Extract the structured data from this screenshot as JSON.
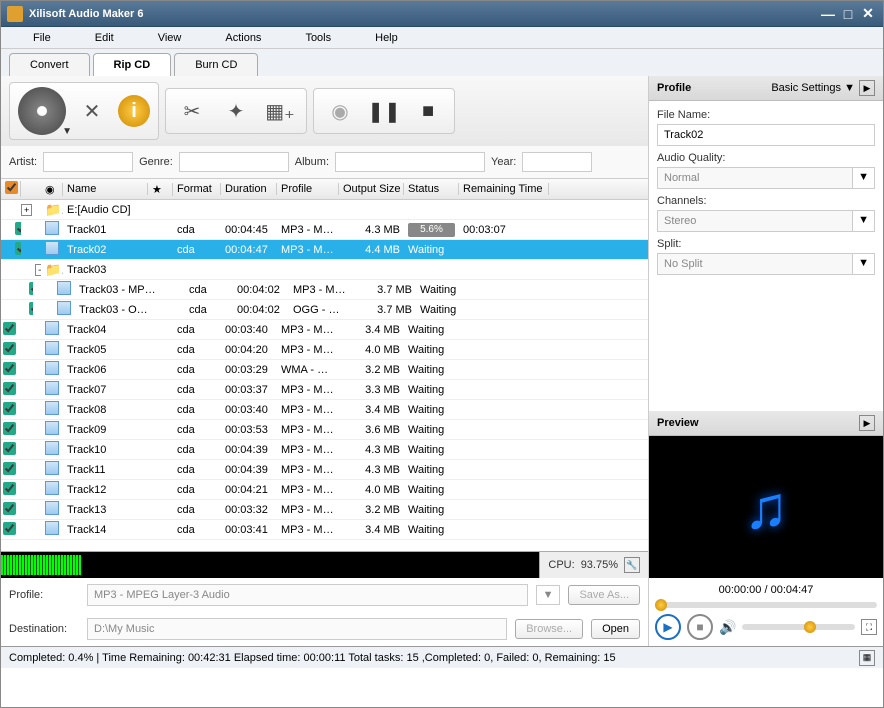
{
  "window": {
    "title": "Xilisoft Audio Maker 6"
  },
  "menu": [
    "File",
    "Edit",
    "View",
    "Actions",
    "Tools",
    "Help"
  ],
  "tabs": [
    {
      "label": "Convert",
      "active": false
    },
    {
      "label": "Rip CD",
      "active": true
    },
    {
      "label": "Burn CD",
      "active": false
    }
  ],
  "meta": {
    "artist_label": "Artist:",
    "artist": "",
    "genre_label": "Genre:",
    "genre": "",
    "album_label": "Album:",
    "album": "",
    "year_label": "Year:",
    "year": ""
  },
  "columns": {
    "name": "Name",
    "format": "Format",
    "duration": "Duration",
    "profile": "Profile",
    "outsize": "Output Size",
    "status": "Status",
    "remaining": "Remaining Time"
  },
  "rows": [
    {
      "type": "group",
      "icon": "folder-open",
      "name": "E:[Audio CD]",
      "expanded": true
    },
    {
      "type": "item",
      "checked": true,
      "name": "Track01",
      "format": "cda",
      "duration": "00:04:45",
      "profile": "MP3 - MP...",
      "size": "4.3 MB",
      "status_pct": "5.6%",
      "remaining": "00:03:07",
      "ind": 1
    },
    {
      "type": "item",
      "checked": true,
      "name": "Track02",
      "format": "cda",
      "duration": "00:04:47",
      "profile": "MP3 - MP...",
      "size": "4.4 MB",
      "status": "Waiting",
      "selected": true,
      "ind": 1
    },
    {
      "type": "group",
      "icon": "folder-minus",
      "name": "Track03",
      "ind": 1
    },
    {
      "type": "item",
      "checked": true,
      "icon": "doc",
      "name": "Track03 - MP3...",
      "format": "cda",
      "duration": "00:04:02",
      "profile": "MP3 - MP...",
      "size": "3.7 MB",
      "status": "Waiting",
      "ind": 2
    },
    {
      "type": "item",
      "checked": true,
      "icon": "doc",
      "name": "Track03 - OGG...",
      "format": "cda",
      "duration": "00:04:02",
      "profile": "OGG - Og...",
      "size": "3.7 MB",
      "status": "Waiting",
      "ind": 2
    },
    {
      "type": "item",
      "checked": true,
      "name": "Track04",
      "format": "cda",
      "duration": "00:03:40",
      "profile": "MP3 - MP...",
      "size": "3.4 MB",
      "status": "Waiting"
    },
    {
      "type": "item",
      "checked": true,
      "name": "Track05",
      "format": "cda",
      "duration": "00:04:20",
      "profile": "MP3 - MP...",
      "size": "4.0 MB",
      "status": "Waiting"
    },
    {
      "type": "item",
      "checked": true,
      "name": "Track06",
      "format": "cda",
      "duration": "00:03:29",
      "profile": "WMA - Wi...",
      "size": "3.2 MB",
      "status": "Waiting"
    },
    {
      "type": "item",
      "checked": true,
      "name": "Track07",
      "format": "cda",
      "duration": "00:03:37",
      "profile": "MP3 - MP...",
      "size": "3.3 MB",
      "status": "Waiting"
    },
    {
      "type": "item",
      "checked": true,
      "name": "Track08",
      "format": "cda",
      "duration": "00:03:40",
      "profile": "MP3 - MP...",
      "size": "3.4 MB",
      "status": "Waiting"
    },
    {
      "type": "item",
      "checked": true,
      "name": "Track09",
      "format": "cda",
      "duration": "00:03:53",
      "profile": "MP3 - MP...",
      "size": "3.6 MB",
      "status": "Waiting"
    },
    {
      "type": "item",
      "checked": true,
      "name": "Track10",
      "format": "cda",
      "duration": "00:04:39",
      "profile": "MP3 - MP...",
      "size": "4.3 MB",
      "status": "Waiting"
    },
    {
      "type": "item",
      "checked": true,
      "name": "Track11",
      "format": "cda",
      "duration": "00:04:39",
      "profile": "MP3 - MP...",
      "size": "4.3 MB",
      "status": "Waiting"
    },
    {
      "type": "item",
      "checked": true,
      "name": "Track12",
      "format": "cda",
      "duration": "00:04:21",
      "profile": "MP3 - MP...",
      "size": "4.0 MB",
      "status": "Waiting"
    },
    {
      "type": "item",
      "checked": true,
      "name": "Track13",
      "format": "cda",
      "duration": "00:03:32",
      "profile": "MP3 - MP...",
      "size": "3.2 MB",
      "status": "Waiting"
    },
    {
      "type": "item",
      "checked": true,
      "name": "Track14",
      "format": "cda",
      "duration": "00:03:41",
      "profile": "MP3 - MP...",
      "size": "3.4 MB",
      "status": "Waiting"
    }
  ],
  "cpu": {
    "label": "CPU:",
    "value": "93.75%"
  },
  "bottom": {
    "profile_label": "Profile:",
    "profile": "MP3 - MPEG Layer-3 Audio",
    "saveas": "Save As...",
    "dest_label": "Destination:",
    "dest": "D:\\My Music",
    "browse": "Browse...",
    "open": "Open"
  },
  "status": "Completed: 0.4% | Time Remaining: 00:42:31 Elapsed time: 00:00:11 Total tasks: 15 ,Completed: 0, Failed: 0, Remaining: 15",
  "profile_panel": {
    "title": "Profile",
    "basic": "Basic Settings",
    "filename_label": "File Name:",
    "filename": "Track02",
    "quality_label": "Audio Quality:",
    "quality": "Normal",
    "channels_label": "Channels:",
    "channels": "Stereo",
    "split_label": "Split:",
    "split": "No Split"
  },
  "preview": {
    "title": "Preview",
    "time": "00:00:00 / 00:04:47"
  }
}
